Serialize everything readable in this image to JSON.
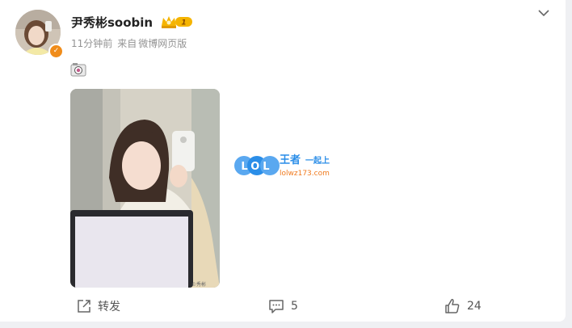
{
  "post": {
    "username": "尹秀彬soobin",
    "vip_badge": "1",
    "time": "11分钟前",
    "source_prefix": "来自",
    "source": "微博网页版",
    "text_emoji": "camera-icon"
  },
  "watermark": {
    "logo": "LOL",
    "brand": "王者",
    "tagline": "一起上",
    "domain": "lolwz173.com"
  },
  "actions": {
    "repost_label": "转发",
    "comment_count": "5",
    "like_count": "24"
  },
  "colors": {
    "accent_orange": "#f08c1a",
    "crown_gold": "#f5b400",
    "watermark_blue": "#2b8ee8",
    "watermark_orange": "#f07a1e"
  }
}
